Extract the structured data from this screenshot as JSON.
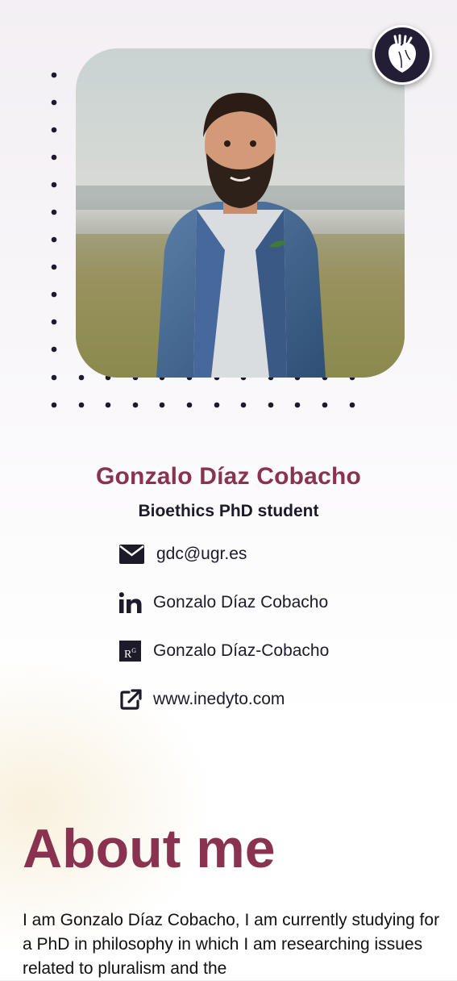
{
  "profile": {
    "name": "Gonzalo Díaz Cobacho",
    "role": "Bioethics PhD student",
    "photo_alt": "Gonzalo Díaz Cobacho portrait"
  },
  "contacts": {
    "email": {
      "icon": "envelope-icon",
      "text": "gdc@ugr.es"
    },
    "linkedin": {
      "icon": "linkedin-icon",
      "text": "Gonzalo Díaz Cobacho"
    },
    "researchgate": {
      "icon": "researchgate-icon",
      "icon_text": "R",
      "icon_sup": "G",
      "text": "Gonzalo Díaz-Cobacho"
    },
    "website": {
      "icon": "external-link-icon",
      "text": "www.inedyto.com"
    }
  },
  "badge": {
    "icon": "anatomical-heart-icon"
  },
  "about": {
    "title": "About me",
    "text": "I am Gonzalo Díaz Cobacho, I am currently studying for a PhD in philosophy in which I am researching issues related to pluralism and the"
  },
  "colors": {
    "accent": "#8a3350",
    "text_dark": "#1d1a2a",
    "badge_bg": "#231d36"
  }
}
